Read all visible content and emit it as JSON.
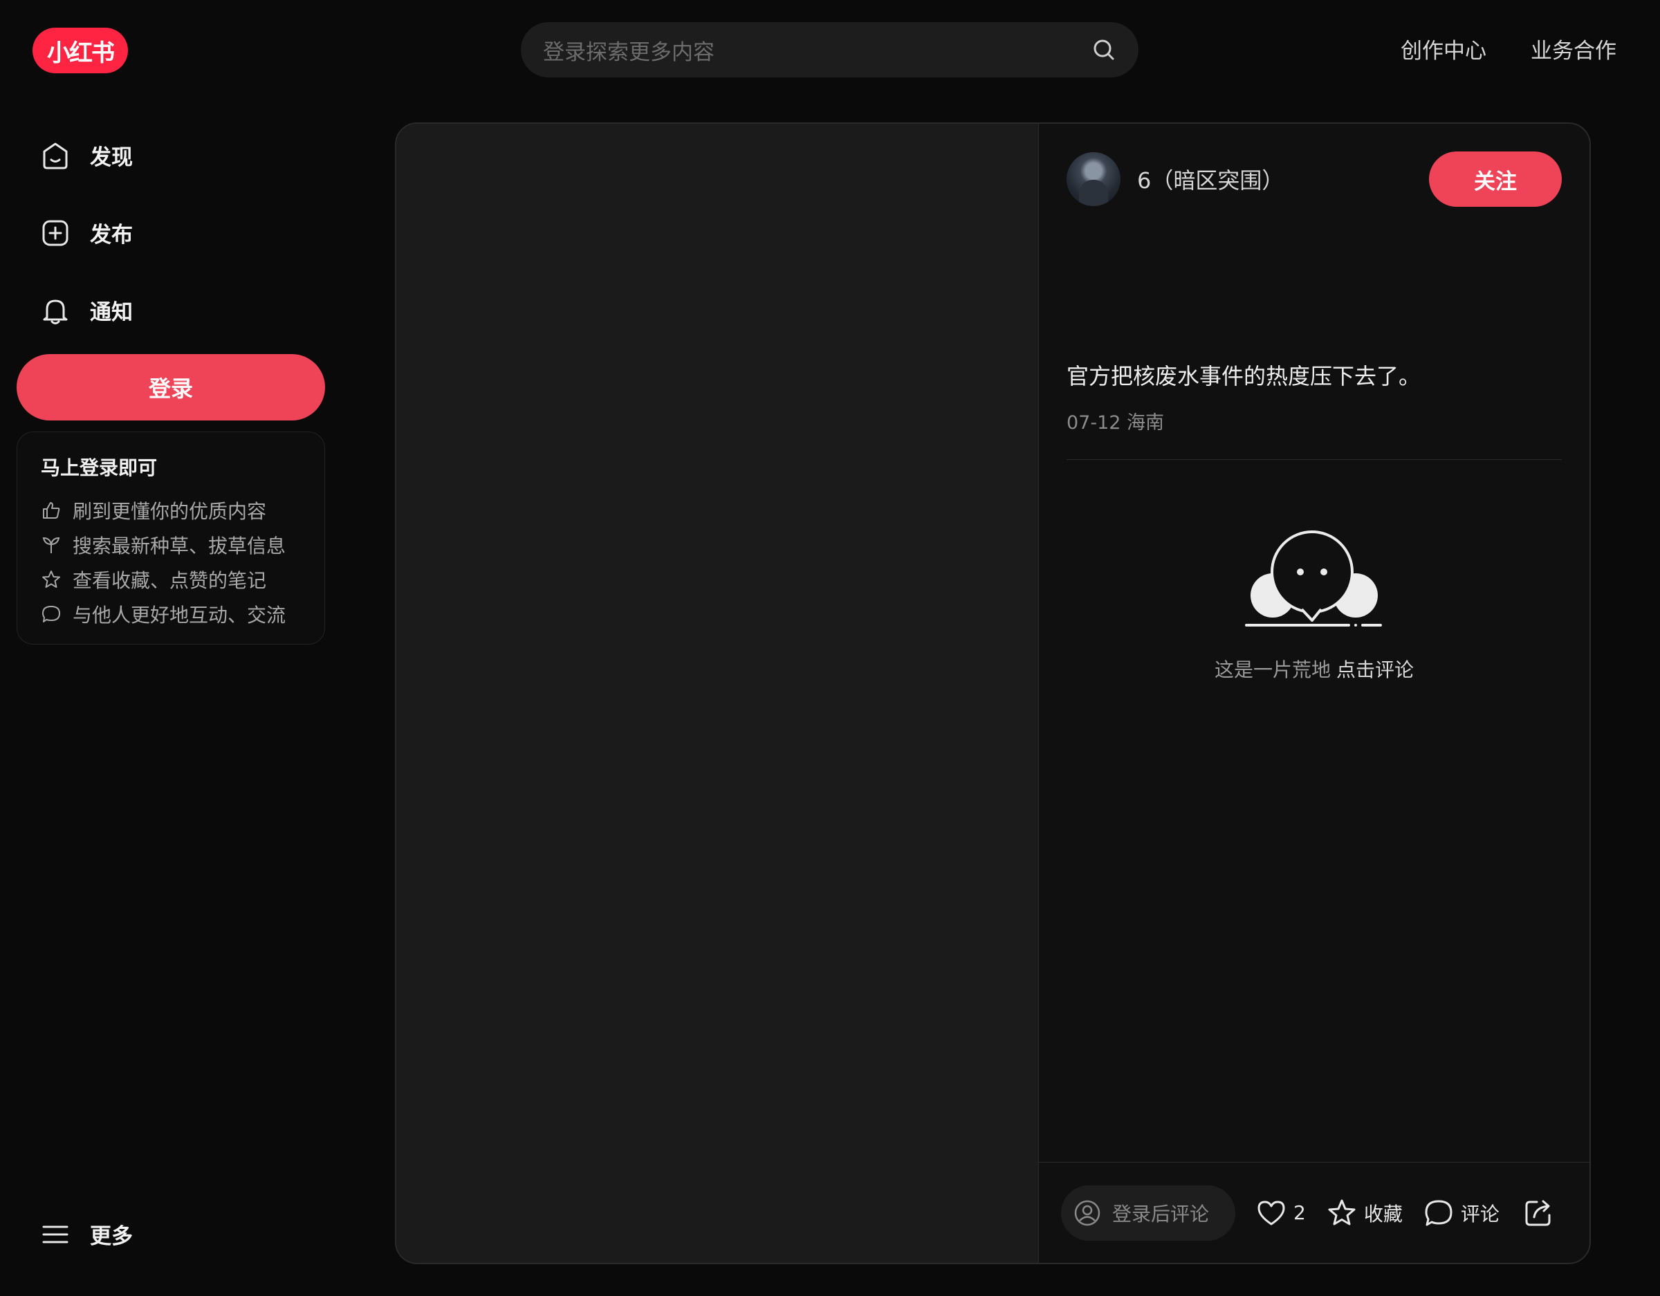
{
  "header": {
    "logo_text": "小红书",
    "search_placeholder": "登录探索更多内容",
    "links": [
      "创作中心",
      "业务合作"
    ]
  },
  "sidebar": {
    "items": [
      {
        "label": "发现",
        "icon": "home-icon"
      },
      {
        "label": "发布",
        "icon": "add-square-icon"
      },
      {
        "label": "通知",
        "icon": "bell-icon"
      }
    ],
    "login_label": "登录",
    "promo": {
      "title": "马上登录即可",
      "rows": [
        {
          "icon": "thumbs-up-icon",
          "text": "刷到更懂你的优质内容"
        },
        {
          "icon": "sprout-icon",
          "text": "搜索最新种草、拔草信息"
        },
        {
          "icon": "star-icon",
          "text": "查看收藏、点赞的笔记"
        },
        {
          "icon": "chat-bubble-icon",
          "text": "与他人更好地互动、交流"
        }
      ]
    },
    "more_label": "更多"
  },
  "note": {
    "author_name": "6（暗区突围）",
    "follow_label": "关注",
    "text": "官方把核废水事件的热度压下去了。",
    "date_location": "07-12 海南",
    "empty_text": "这是一片荒地",
    "empty_link": "点击评论"
  },
  "bottom_bar": {
    "comment_placeholder": "登录后评论",
    "like_count": "2",
    "collect_label": "收藏",
    "comment_label": "评论"
  },
  "colors": {
    "brand": "#ff2442",
    "button": "#ef4458",
    "background": "#0a0a0a"
  }
}
